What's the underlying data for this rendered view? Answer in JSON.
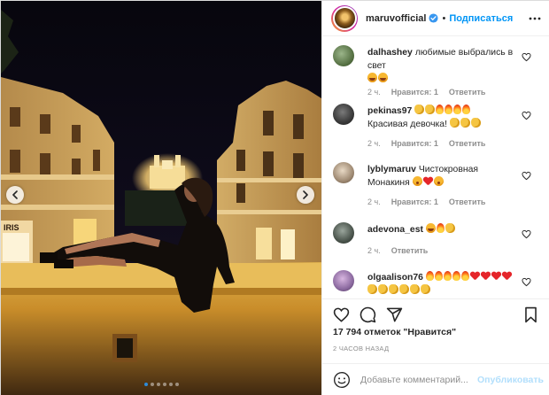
{
  "post": {
    "username": "maruvofficial",
    "separator": "•",
    "follow_label": "Подписаться",
    "verified": true
  },
  "photo": {
    "icon_left": "chevron-left-icon",
    "icon_right": "chevron-right-icon",
    "carousel_count": 6,
    "carousel_active_index": 0,
    "dot_active_color": "#2e8bd9"
  },
  "comments": [
    {
      "user": "dalhashey",
      "text": "любимые выбрались в свет",
      "emojis": [
        "laugh",
        "laugh"
      ],
      "time": "2 ч.",
      "likes": "Нравится: 1",
      "reply": "Ответить"
    },
    {
      "user": "pekinas97",
      "text": "",
      "emojis": [
        "clap",
        "clap",
        "fire",
        "fire",
        "fire",
        "fire"
      ],
      "text2": "Красивая девочка!",
      "emojis2": [
        "clap",
        "clap",
        "clap"
      ],
      "time": "2 ч.",
      "likes": "Нравится: 1",
      "reply": "Ответить"
    },
    {
      "user": "lyblymaruv",
      "text": "Чистокровная Монакиня",
      "emojis": [
        "shy",
        "heart",
        "shy"
      ],
      "time": "2 ч.",
      "likes": "Нравится: 1",
      "reply": "Ответить"
    },
    {
      "user": "adevona_est",
      "text": "",
      "emojis": [
        "laugh",
        "fire",
        "clap"
      ],
      "time": "2 ч.",
      "likes": "",
      "reply": "Ответить"
    },
    {
      "user": "olgaalison76",
      "text": "",
      "emojis": [
        "fire",
        "fire",
        "fire",
        "fire",
        "fire",
        "heart",
        "heart",
        "heart",
        "heart",
        "clap",
        "clap",
        "clap",
        "clap",
        "clap",
        "clap"
      ],
      "time": "",
      "likes": "",
      "reply": ""
    }
  ],
  "actions": {
    "like_icon": "heart-icon",
    "comment_icon": "comment-icon",
    "share_icon": "share-icon",
    "save_icon": "bookmark-icon"
  },
  "likes_text": "17 794 отметок \"Нравится\"",
  "time_text": "2 ЧАСОВ НАЗАД",
  "add_comment": {
    "placeholder": "Добавьте комментарий...",
    "publish_label": "Опубликовать"
  },
  "colors": {
    "link": "#0095f6",
    "muted": "#8e8e8e",
    "publish_disabled": "#b2dffc"
  }
}
